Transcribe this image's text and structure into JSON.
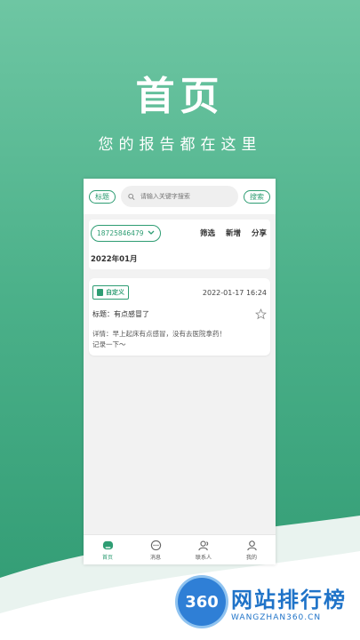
{
  "hero": {
    "title": "首页",
    "subtitle": "您的报告都在这里"
  },
  "top_bar": {
    "title_tag": "标题",
    "search_placeholder": "请输入关键字搜索",
    "search_button": "搜索"
  },
  "filter": {
    "phone": "18725846479",
    "actions": [
      "筛选",
      "新增",
      "分享"
    ]
  },
  "month_header": "2022年01月",
  "record": {
    "tag": "自定义",
    "time": "2022-01-17 16:24",
    "title": "标题：有点感冒了",
    "detail_line1": "详情：早上起床有点感冒，没有去医院拿药！",
    "detail_line2": "记录一下～"
  },
  "tabbar": {
    "items": [
      {
        "label": "首页",
        "icon": "home-icon"
      },
      {
        "label": "消息",
        "icon": "message-icon"
      },
      {
        "label": "联系人",
        "icon": "contacts-icon"
      },
      {
        "label": "我的",
        "icon": "profile-icon"
      }
    ]
  },
  "watermark": {
    "logo_number": "360",
    "name": "网站排行榜",
    "url": "WANGZHAN360.CN"
  },
  "colors": {
    "accent": "#2e9d73",
    "bg_gradient_top": "#6ec6a3",
    "bg_gradient_bottom": "#2f9a72"
  }
}
